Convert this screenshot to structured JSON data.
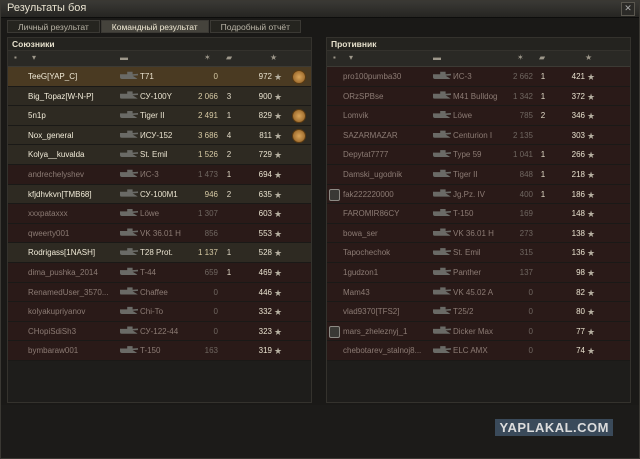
{
  "window": {
    "title": "Результаты боя"
  },
  "tabs": [
    {
      "label": "Личный результат",
      "active": false
    },
    {
      "label": "Командный результат",
      "active": true
    },
    {
      "label": "Подробный отчёт",
      "active": false
    }
  ],
  "allies": {
    "title": "Союзники",
    "rows": [
      {
        "name": "TeeG[YAP_C]",
        "vehicle": "T71",
        "damage": "0",
        "kills": "",
        "xp": "972",
        "state": "self",
        "medal": true
      },
      {
        "name": "Big_Topaz[W-N-P]",
        "vehicle": "СУ-100Y",
        "damage": "2 066",
        "kills": "3",
        "xp": "900",
        "state": "alive",
        "medal": false
      },
      {
        "name": "5n1p",
        "vehicle": "Tiger II",
        "damage": "2 491",
        "kills": "1",
        "xp": "829",
        "state": "alive",
        "medal": true
      },
      {
        "name": "Nox_general",
        "vehicle": "ИСУ-152",
        "damage": "3 686",
        "kills": "4",
        "xp": "811",
        "state": "alive",
        "medal": true
      },
      {
        "name": "Kolya__kuvalda",
        "vehicle": "St. Emil",
        "damage": "1 526",
        "kills": "2",
        "xp": "729",
        "state": "alive",
        "medal": false
      },
      {
        "name": "andrechelyshev",
        "vehicle": "ИС-3",
        "damage": "1 473",
        "kills": "1",
        "xp": "694",
        "state": "dead",
        "medal": false
      },
      {
        "name": "kfjdhvkvn[TMB68]",
        "vehicle": "СУ-100М1",
        "damage": "946",
        "kills": "2",
        "xp": "635",
        "state": "alive",
        "medal": false
      },
      {
        "name": "xxxpataxxx",
        "vehicle": "Löwe",
        "damage": "1 307",
        "kills": "",
        "xp": "603",
        "state": "dead",
        "medal": false
      },
      {
        "name": "qweerty001",
        "vehicle": "VK 36.01 H",
        "damage": "856",
        "kills": "",
        "xp": "553",
        "state": "dead",
        "medal": false
      },
      {
        "name": "Rodrigass[1NASH]",
        "vehicle": "T28 Prot.",
        "damage": "1 137",
        "kills": "1",
        "xp": "528",
        "state": "alive",
        "medal": false
      },
      {
        "name": "dima_pushka_2014",
        "vehicle": "T-44",
        "damage": "659",
        "kills": "1",
        "xp": "469",
        "state": "dead",
        "medal": false
      },
      {
        "name": "RenamedUser_3570...",
        "vehicle": "Chaffee",
        "damage": "0",
        "kills": "",
        "xp": "446",
        "state": "dead",
        "medal": false
      },
      {
        "name": "kolyakupriyanov",
        "vehicle": "Chi-To",
        "damage": "0",
        "kills": "",
        "xp": "332",
        "state": "dead",
        "medal": false
      },
      {
        "name": "CHopiSdiSh3",
        "vehicle": "СУ-122-44",
        "damage": "0",
        "kills": "",
        "xp": "323",
        "state": "dead",
        "medal": false
      },
      {
        "name": "bymbaraw001",
        "vehicle": "T-150",
        "damage": "163",
        "kills": "",
        "xp": "319",
        "state": "dead",
        "medal": false
      }
    ]
  },
  "enemies": {
    "title": "Противник",
    "rows": [
      {
        "name": "pro100pumba30",
        "vehicle": "ИС-3",
        "damage": "2 662",
        "kills": "1",
        "xp": "421",
        "state": "dead",
        "icon": false
      },
      {
        "name": "ORzSPBse",
        "vehicle": "M41 Bulldog",
        "damage": "1 342",
        "kills": "1",
        "xp": "372",
        "state": "dead",
        "icon": false
      },
      {
        "name": "Lomvik",
        "vehicle": "Löwe",
        "damage": "785",
        "kills": "2",
        "xp": "346",
        "state": "dead",
        "icon": false
      },
      {
        "name": "SAZARMAZAR",
        "vehicle": "Centurion I",
        "damage": "2 135",
        "kills": "",
        "xp": "303",
        "state": "dead",
        "icon": false
      },
      {
        "name": "Depytat7777",
        "vehicle": "Type 59",
        "damage": "1 041",
        "kills": "1",
        "xp": "266",
        "state": "dead",
        "icon": false
      },
      {
        "name": "Damski_ugodnik",
        "vehicle": "Tiger II",
        "damage": "848",
        "kills": "1",
        "xp": "218",
        "state": "dead",
        "icon": false
      },
      {
        "name": "fak222220000",
        "vehicle": "Jg.Pz. IV",
        "damage": "400",
        "kills": "1",
        "xp": "186",
        "state": "dead",
        "icon": true
      },
      {
        "name": "FAROMIR86CY",
        "vehicle": "T-150",
        "damage": "169",
        "kills": "",
        "xp": "148",
        "state": "dead",
        "icon": false
      },
      {
        "name": "bowa_ser",
        "vehicle": "VK 36.01 H",
        "damage": "273",
        "kills": "",
        "xp": "138",
        "state": "dead",
        "icon": false
      },
      {
        "name": "Tapochechok",
        "vehicle": "St. Emil",
        "damage": "315",
        "kills": "",
        "xp": "136",
        "state": "dead",
        "icon": false
      },
      {
        "name": "1gudzon1",
        "vehicle": "Panther",
        "damage": "137",
        "kills": "",
        "xp": "98",
        "state": "dead",
        "icon": false
      },
      {
        "name": "Mam43",
        "vehicle": "VK 45.02 A",
        "damage": "0",
        "kills": "",
        "xp": "82",
        "state": "dead",
        "icon": false
      },
      {
        "name": "vlad9370[TFS2]",
        "vehicle": "T25/2",
        "damage": "0",
        "kills": "",
        "xp": "80",
        "state": "dead",
        "icon": false
      },
      {
        "name": "mars_zheleznyj_1",
        "vehicle": "Dicker Max",
        "damage": "0",
        "kills": "",
        "xp": "77",
        "state": "dead",
        "icon": true
      },
      {
        "name": "chebotarev_stalnoj8...",
        "vehicle": "ELC AMX",
        "damage": "0",
        "kills": "",
        "xp": "74",
        "state": "dead",
        "icon": false
      }
    ]
  },
  "watermark": "YAPLAKAL.COM",
  "colors": {
    "alive_row": "#2e2a22",
    "dead_row": "#2a1a18",
    "self_row": "#4a3a22"
  }
}
